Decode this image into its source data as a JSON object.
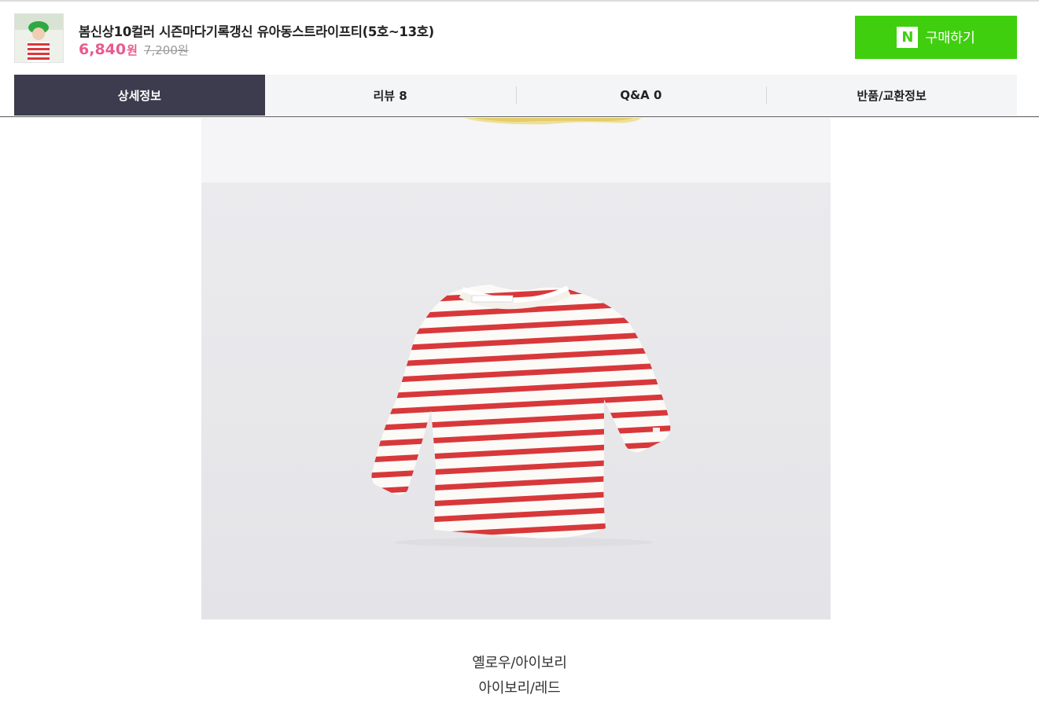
{
  "product": {
    "title": "봄신상10컬러 시즌마다기록갱신 유아동스트라이프티(5호~13호)",
    "price_sale": "6,840",
    "price_sale_unit": "원",
    "price_original": "7,200원"
  },
  "buy_button": {
    "logo_text": "N",
    "label": "구매하기",
    "color": "#3fcf0e"
  },
  "tabs": [
    {
      "label": "상세정보",
      "active": true
    },
    {
      "label": "리뷰 8",
      "active": false
    },
    {
      "label": "Q&A 0",
      "active": false
    },
    {
      "label": "반품/교환정보",
      "active": false
    }
  ],
  "detail": {
    "color_options": [
      "옐로우/아이보리",
      "아이보리/레드"
    ]
  },
  "colors": {
    "sale_price": "#e85b8f",
    "active_tab": "#3c3c4e",
    "stripe": "#d8383a"
  }
}
